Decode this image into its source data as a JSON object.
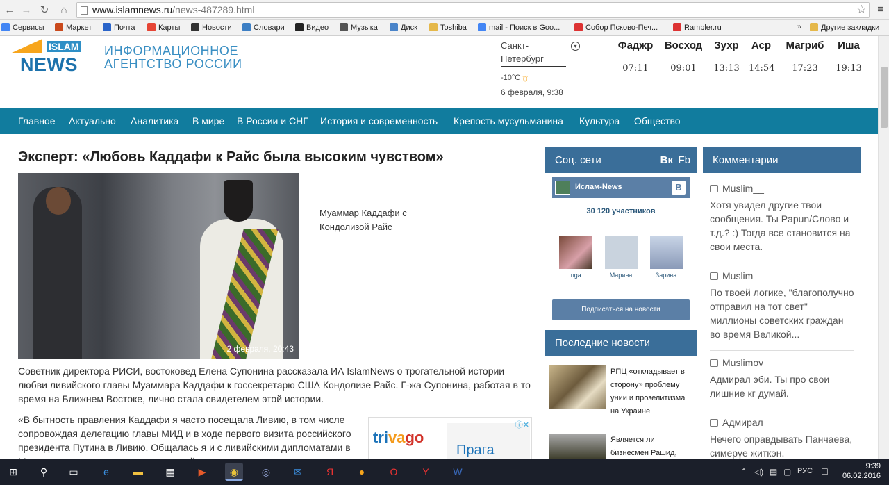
{
  "browser": {
    "url_host": "www.islamnews.ru",
    "url_path": "/news-487289.html",
    "bookmarks": [
      {
        "label": "Сервисы",
        "color": "#4285f4"
      },
      {
        "label": "Маркет",
        "color": "#c9491c"
      },
      {
        "label": "Почта",
        "color": "#2a64c9"
      },
      {
        "label": "Карты",
        "color": "#e64535"
      },
      {
        "label": "Новости",
        "color": "#333333"
      },
      {
        "label": "Словари",
        "color": "#3d7fc4"
      },
      {
        "label": "Видео",
        "color": "#222222"
      },
      {
        "label": "Музыка",
        "color": "#555555"
      },
      {
        "label": "Диск",
        "color": "#4a84c9"
      },
      {
        "label": "Toshiba",
        "color": "#e5b84a"
      },
      {
        "label": "mail - Поиск в Goo...",
        "color": "#4285f4"
      },
      {
        "label": "Собор Псково-Печ...",
        "color": "#dd3333"
      },
      {
        "label": "Rambler.ru",
        "color": "#dd3333"
      }
    ],
    "more": "»",
    "other_bookmarks": "Другие закладки"
  },
  "site": {
    "logo_islam": "ISLAM",
    "logo_news": "NEWS",
    "agency_line1": "ИНФОРМАЦИОННОЕ",
    "agency_line2": "АГЕНТСТВО РОССИИ",
    "accent": "#117c9e"
  },
  "weather": {
    "city_line1": "Санкт-",
    "city_line2": "Петербург",
    "temp": "-10°C",
    "date": "6 февраля, 9:38"
  },
  "prayers": [
    {
      "name": "Фаджр",
      "time": "07:11"
    },
    {
      "name": "Восход",
      "time": "09:01"
    },
    {
      "name": "Зухр",
      "time": "13:13"
    },
    {
      "name": "Аср",
      "time": "14:54"
    },
    {
      "name": "Магриб",
      "time": "17:23"
    },
    {
      "name": "Иша",
      "time": "19:13"
    }
  ],
  "nav": [
    "Главное",
    "Актуально",
    "Аналитика",
    "В мире",
    "В России и СНГ",
    "История и современность",
    "Крепость мусульманина",
    "Культура",
    "Общество"
  ],
  "article": {
    "headline": "Эксперт: «Любовь Каддафи к Райс была высоким чувством»",
    "photo_date": "2 февраля, 20:43",
    "caption": "Муаммар Каддафи с Кондолизой Райс",
    "lead": "Советник директора РИСИ, востоковед Елена Супонина рассказала ИА IslamNews о трогательной истории любви ливийского главы Муаммара Каддафи к госсекретарю США Кондолизе Райс. Г-жа Супонина, работая в то время на Ближнем Востоке, лично стала свидетелем этой истории.",
    "quote": "«В бытность правления Каддафи я часто посещала Ливию, в том числе сопровождая делегацию главы МИД и в ходе первого визита российского президента Путина в Ливию. Общалась я и с ливийскими дипломатами в Москве, так что стала свидетелем этой истории."
  },
  "ad": {
    "brand_1": "tri",
    "brand_2": "va",
    "brand_3": "go",
    "city": "Прага"
  },
  "social": {
    "title": "Соц. сети",
    "vk": "Вк",
    "fb": "Fb",
    "group_name": "Ислам-News",
    "members": "30 120 участников",
    "friends": [
      "Inga",
      "Марина",
      "Зарина"
    ],
    "subscribe": "Подписаться на новости"
  },
  "latest": {
    "title": "Последние новости",
    "items": [
      {
        "text": "РПЦ «откладывает в сторону» проблему унии и прозелитизма на Украине"
      },
      {
        "text": "Является ли бизнесмен Рашид, "
      }
    ]
  },
  "comments": {
    "title": "Комментарии",
    "items": [
      {
        "author": "Muslim__",
        "text": "Хотя увидел другие твои сообщения. Ты Papun/Слово и т.д.? :) Тогда все становится на свои места."
      },
      {
        "author": "Muslim__",
        "text": "По твоей логике, \"благополучно отправил на тот свет\" миллионы советских граждан во время Великой..."
      },
      {
        "author": "Muslimov",
        "text": "Адмирал эби. Ты про свои лишние кг думай."
      },
      {
        "author": "Адмирал",
        "text": "Нечего оправдывать Панчаева, симерүе житкэн."
      }
    ]
  },
  "tray": {
    "lang": "РУС",
    "time": "9:39",
    "date": "06.02.2016"
  }
}
